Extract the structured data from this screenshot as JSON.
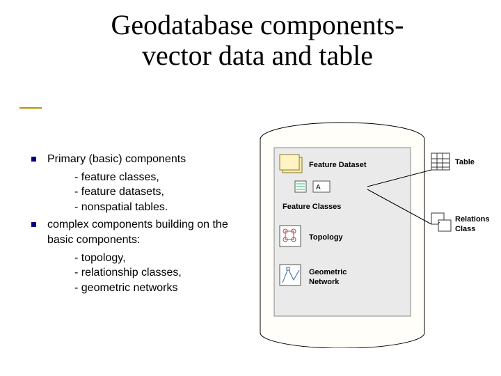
{
  "title_line1": "Geodatabase components-",
  "title_line2": "vector data and table",
  "bullets": [
    {
      "text": "Primary (basic) components",
      "subs": [
        "- feature classes,",
        "- feature datasets,",
        "- nonspatial tables."
      ]
    },
    {
      "text": "complex components building on the basic components:",
      "subs": [
        "- topology,",
        "- relationship classes,",
        "- geometric networks"
      ]
    }
  ],
  "figure": {
    "labels": {
      "feature_dataset": "Feature Dataset",
      "feature_classes": "Feature Classes",
      "topology": "Topology",
      "geometric_network": "Geometric Network",
      "table": "Table",
      "relationship_class": "Relationship Class",
      "a_sample": "A"
    }
  }
}
